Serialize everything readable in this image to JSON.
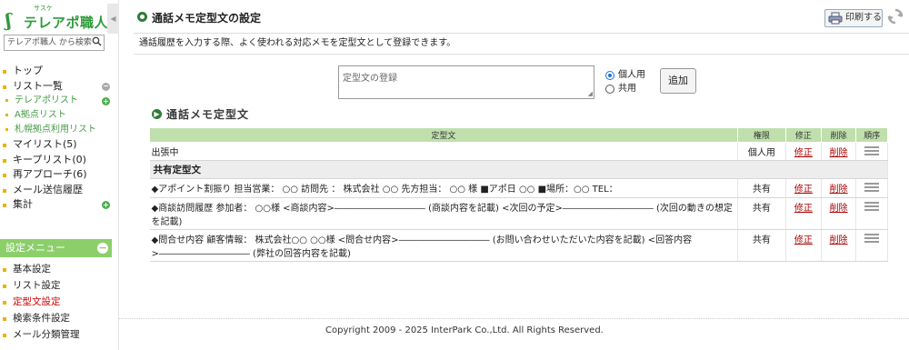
{
  "sidebar": {
    "logo_ruby": "サスケ",
    "logo_text": "テレアポ職人",
    "collapse_glyph": "◀",
    "search_placeholder": "テレアポ職人 から検索",
    "nav": [
      {
        "label": "トップ"
      },
      {
        "label": "リスト一覧"
      },
      {
        "label": "テレアポリスト"
      },
      {
        "label": "A拠点リスト"
      },
      {
        "label": "札幌拠点利用リスト"
      },
      {
        "label": "マイリスト(5)"
      },
      {
        "label": "キープリスト(0)"
      },
      {
        "label": "再アプローチ(6)"
      },
      {
        "label": "メール送信履歴"
      },
      {
        "label": "集計"
      }
    ],
    "settings_header": "設定メニュー",
    "settings_nav": [
      {
        "label": "基本設定"
      },
      {
        "label": "リスト設定"
      },
      {
        "label": "定型文設定"
      },
      {
        "label": "検索条件設定"
      },
      {
        "label": "メール分類管理"
      }
    ]
  },
  "main": {
    "page_title": "通話メモ定型文の設定",
    "print_label": "印刷する",
    "description": "通話履歴を入力する際、よく使われる対応メモを定型文として登録できます。",
    "input_placeholder": "定型文の登録",
    "radio_personal": "個人用",
    "radio_shared": "共用",
    "add_label": "追加",
    "section_title": "通話メモ定型文",
    "table": {
      "headers": {
        "template": "定型文",
        "permission": "権限",
        "edit": "修正",
        "delete": "削除",
        "order": "順序"
      },
      "rows": [
        {
          "text": "出張中",
          "permission": "個人用",
          "edit": "修正",
          "delete": "削除"
        }
      ],
      "group_label": "共有定型文",
      "shared_rows": [
        {
          "text": "◆アポイント割振り 担当営業： ○○ 訪問先 ： 株式会社 ○○ 先方担当： ○○ 様 ■アポ日 ○○ ■場所：○○ TEL：",
          "permission": "共有",
          "edit": "修正",
          "delete": "削除"
        },
        {
          "text": "◆商談訪問履歴 参加者： ○○様 <商談内容>―――――――――― (商談内容を記載) <次回の予定>―――――――――― (次回の動きの想定を記載)",
          "permission": "共有",
          "edit": "修正",
          "delete": "削除"
        },
        {
          "text": "◆問合せ内容 顧客情報： 株式会社○○ ○○様 <問合せ内容>―――――――――― (お問い合わせいただいた内容を記載) <回答内容>―――――――――― (弊社の回答内容を記載)",
          "permission": "共有",
          "edit": "修正",
          "delete": "削除"
        }
      ]
    },
    "copyright": "Copyright 2009 - 2025 InterPark Co.,Ltd. All Rights Reserved."
  }
}
